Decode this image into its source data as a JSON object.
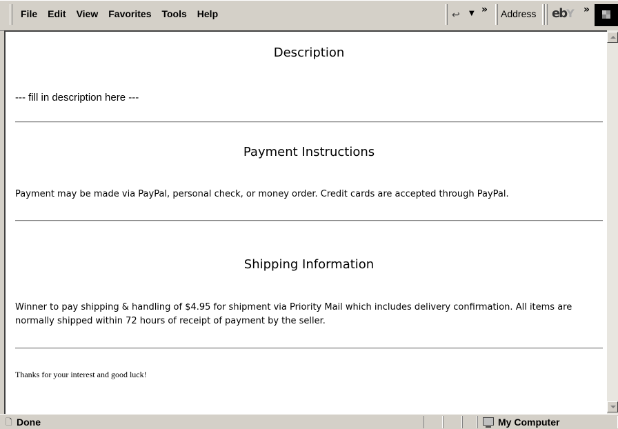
{
  "menu": {
    "items": [
      "File",
      "Edit",
      "View",
      "Favorites",
      "Tools",
      "Help"
    ]
  },
  "toolbar": {
    "back_icon": "back-arrow-icon",
    "chevron": "»",
    "address_label": "Address",
    "brand_logo": "ebY"
  },
  "content": {
    "description": {
      "title": "Description",
      "text": "--- fill in description here ---"
    },
    "payment": {
      "title": "Payment Instructions",
      "text": "Payment may be made via PayPal, personal check, or money order. Credit cards are accepted through PayPal."
    },
    "shipping": {
      "title": "Shipping Information",
      "text": "Winner to pay shipping & handling of $4.95 for shipment via Priority Mail which includes delivery confirmation. All items are normally shipped within 72 hours of receipt of payment by the seller."
    },
    "thanks": {
      "text": "Thanks for your interest and good luck!"
    }
  },
  "statusbar": {
    "status": "Done",
    "zone": "My Computer"
  },
  "colors": {
    "chrome": "#d4d0c8",
    "page_background": "#ffffff",
    "divider": "#808080"
  }
}
